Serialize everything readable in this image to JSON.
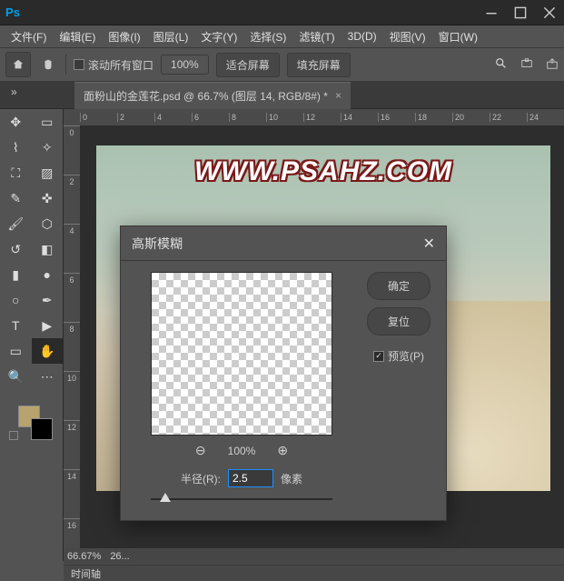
{
  "titlebar": {
    "logo": "Ps"
  },
  "menu": {
    "file": "文件(F)",
    "edit": "编辑(E)",
    "image": "图像(I)",
    "layer": "图层(L)",
    "type": "文字(Y)",
    "select": "选择(S)",
    "filter": "滤镜(T)",
    "threeD": "3D(D)",
    "view": "视图(V)",
    "window": "窗口(W)"
  },
  "options": {
    "scroll_all": "滚动所有窗口",
    "zoom_value": "100%",
    "fit_screen": "适合屏幕",
    "fill_screen": "填充屏幕"
  },
  "document": {
    "tab_title": "面粉山的金莲花.psd @ 66.7% (图层 14, RGB/8#) *",
    "ruler_h": [
      "0",
      "2",
      "4",
      "6",
      "8",
      "10",
      "12",
      "14",
      "16",
      "18",
      "20",
      "22",
      "24"
    ],
    "ruler_v": [
      "0",
      "2",
      "4",
      "6",
      "8",
      "10",
      "12",
      "14",
      "16"
    ],
    "watermark": "WWW.PSAHZ.COM"
  },
  "status": {
    "zoom": "66.67%",
    "info": "26...",
    "timeline": "时间轴"
  },
  "dialog": {
    "title": "高斯模糊",
    "ok": "确定",
    "reset": "复位",
    "preview": "预览(P)",
    "preview_zoom": "100%",
    "radius_label": "半径(R):",
    "radius_value": "2.5",
    "radius_unit": "像素"
  }
}
